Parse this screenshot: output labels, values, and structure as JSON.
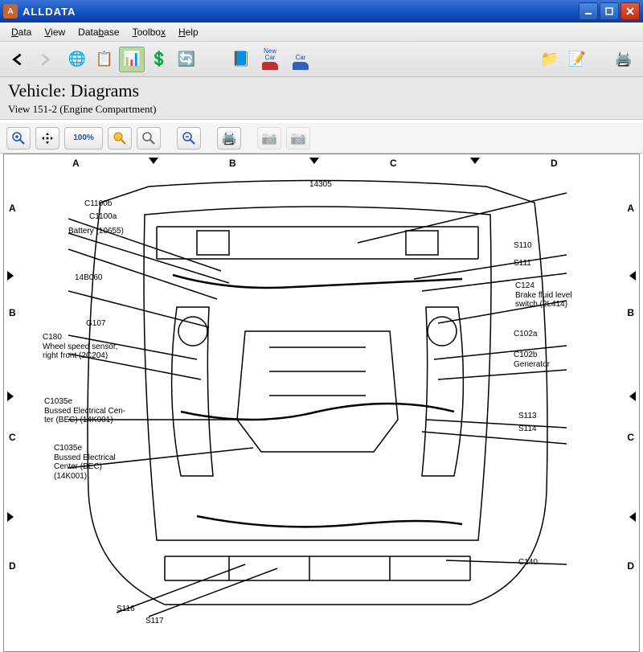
{
  "window": {
    "title": "ALLDATA",
    "icon_letter": "A"
  },
  "menu": {
    "data": "Data",
    "view": "View",
    "database": "Database",
    "toolbox": "Toolbox",
    "help": "Help"
  },
  "toolbar": {
    "new_car": "New",
    "car": "Car"
  },
  "content": {
    "title": "Vehicle:  Diagrams",
    "subtitle": "View 151-2 (Engine Compartment)"
  },
  "viewer": {
    "zoom_fit": "100%"
  },
  "grid": {
    "cols": [
      "A",
      "B",
      "C",
      "D"
    ],
    "rows": [
      "A",
      "B",
      "C",
      "D"
    ]
  },
  "callouts_left": [
    {
      "id": "C1100b",
      "lines": [
        "C1100b"
      ]
    },
    {
      "id": "C1100a",
      "lines": [
        "C1100a"
      ]
    },
    {
      "id": "Battery",
      "lines": [
        "Battery (10655)"
      ]
    },
    {
      "id": "14B060",
      "lines": [
        "14B060"
      ]
    },
    {
      "id": "G107",
      "lines": [
        "G107"
      ]
    },
    {
      "id": "C180",
      "lines": [
        "C180",
        "Wheel speed sensor,",
        "right front (2C204)"
      ]
    },
    {
      "id": "C1035e",
      "lines": [
        "C1035e",
        "Bussed Electrical Cen-",
        "ter (BEC) (14K001)"
      ]
    },
    {
      "id": "C1035e2",
      "lines": [
        "C1035e",
        "Bussed Electrical",
        "Center (BEC)",
        "(14K001)"
      ]
    },
    {
      "id": "S116",
      "lines": [
        "S116"
      ]
    },
    {
      "id": "S117",
      "lines": [
        "S117"
      ]
    }
  ],
  "callouts_right": [
    {
      "id": "14305",
      "lines": [
        "14305"
      ]
    },
    {
      "id": "S110",
      "lines": [
        "S110"
      ]
    },
    {
      "id": "S111",
      "lines": [
        "S111"
      ]
    },
    {
      "id": "C124",
      "lines": [
        "C124",
        "Brake fluid level",
        "switch (2L414)"
      ]
    },
    {
      "id": "C102a",
      "lines": [
        "C102a"
      ]
    },
    {
      "id": "C102b",
      "lines": [
        "C102b",
        "Generator"
      ]
    },
    {
      "id": "S113",
      "lines": [
        "S113"
      ]
    },
    {
      "id": "S114",
      "lines": [
        "S114"
      ]
    },
    {
      "id": "C140",
      "lines": [
        "C140"
      ]
    }
  ]
}
